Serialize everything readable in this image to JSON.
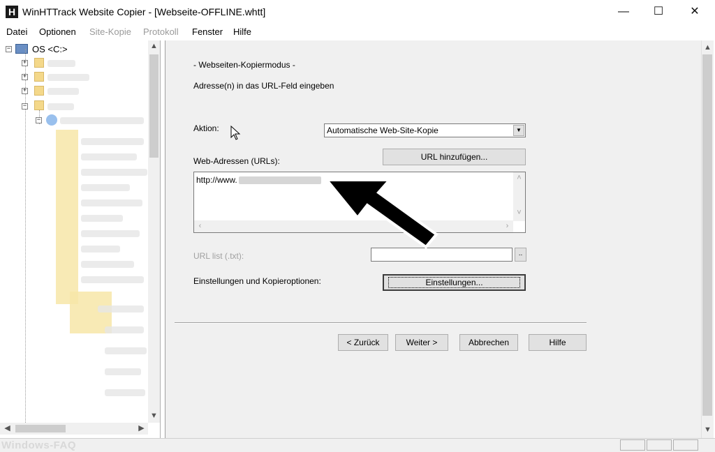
{
  "window": {
    "title": "WinHTTrack Website Copier - [Webseite-OFFLINE.whtt]",
    "app_icon_letter": "H",
    "controls": {
      "minimize": "—",
      "maximize": "☐",
      "close": "✕"
    }
  },
  "menu": {
    "items": [
      {
        "label": "Datei",
        "enabled": true
      },
      {
        "label": "Optionen",
        "enabled": true
      },
      {
        "label": "Site-Kopie",
        "enabled": false
      },
      {
        "label": "Protokoll",
        "enabled": false
      },
      {
        "label": "Fenster",
        "enabled": true
      },
      {
        "label": "Hilfe",
        "enabled": true
      }
    ]
  },
  "tree": {
    "root_label": "OS <C:>"
  },
  "wizard": {
    "mode_title": "- Webseiten-Kopiermodus -",
    "instruction": "Adresse(n) in das URL-Feld eingeben",
    "action_label": "Aktion:",
    "action_value": "Automatische Web-Site-Kopie",
    "urls_label": "Web-Adressen (URLs):",
    "add_url_button": "URL hinzufügen...",
    "url_text_prefix": "http://www.",
    "url_list_label": "URL list (.txt):",
    "browse_button": "..",
    "settings_label": "Einstellungen und Kopieroptionen:",
    "settings_button": "Einstellungen...",
    "buttons": {
      "back": "< Zurück",
      "next": "Weiter >",
      "cancel": "Abbrechen",
      "help": "Hilfe"
    }
  },
  "watermark": "Windows-FAQ"
}
